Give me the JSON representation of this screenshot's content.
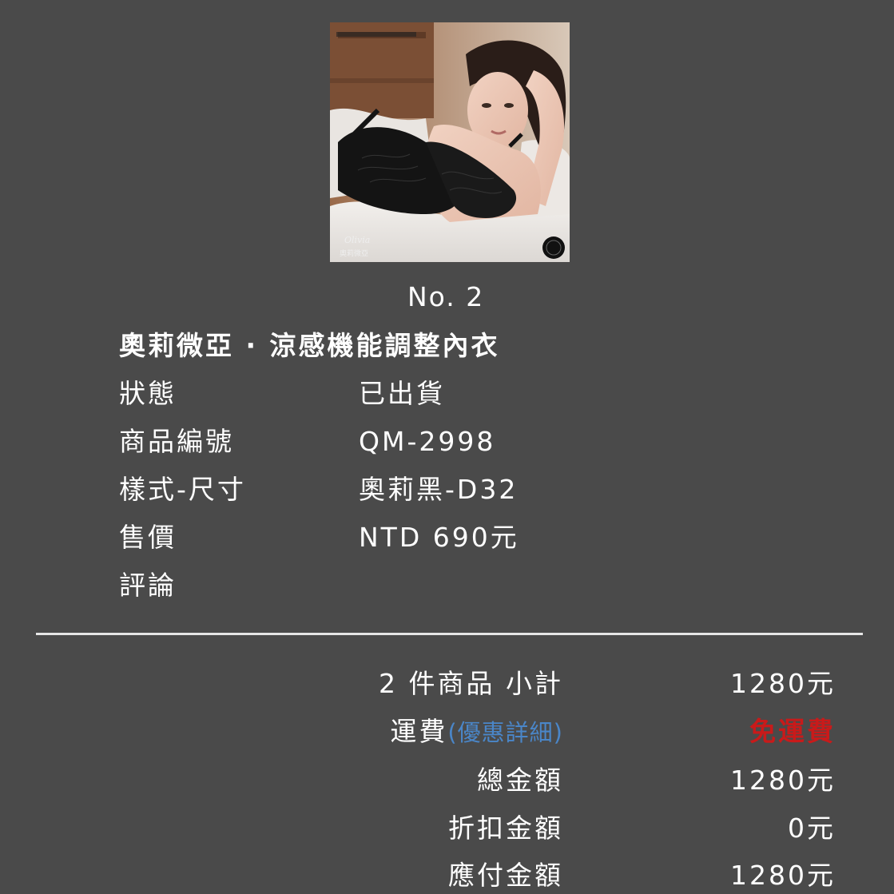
{
  "item": {
    "number": "No. 2",
    "name": "奧莉微亞 · 涼感機能調整內衣",
    "image_icon": "product-photo",
    "image_caption_script": "Olivia",
    "image_caption_cn": "奧莉微亞"
  },
  "details": [
    {
      "label": "狀態",
      "value": "已出貨"
    },
    {
      "label": "商品編號",
      "value": "QM-2998"
    },
    {
      "label": "樣式-尺寸",
      "value": "奧莉黑-D32"
    },
    {
      "label": "售價",
      "value": "NTD 690元"
    },
    {
      "label": "評論",
      "value": ""
    }
  ],
  "summary": {
    "subtotal_label": "2 件商品 小計",
    "subtotal_value": "1280元",
    "shipping_label": "運費",
    "shipping_link": "(優惠詳細)",
    "shipping_value": "免運費",
    "total_label": "總金額",
    "total_value": "1280元",
    "discount_label": "折扣金額",
    "discount_value": "0元",
    "payable_label": "應付金額",
    "payable_value": "1280元"
  },
  "colors": {
    "background": "#4a4a4a",
    "text": "#ffffff",
    "link": "#4a86c8",
    "free_shipping": "#c91a1a",
    "divider": "#e6e6e6"
  }
}
